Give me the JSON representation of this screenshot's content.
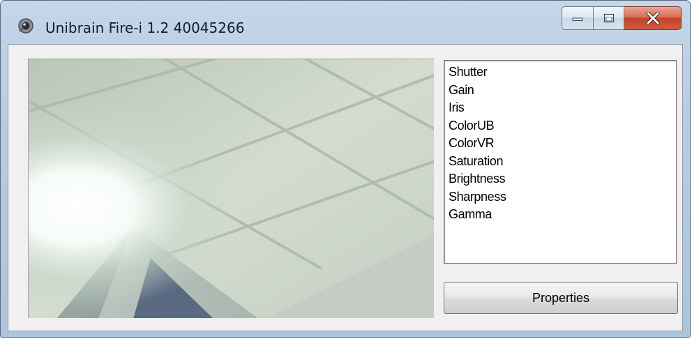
{
  "window": {
    "title": "Unibrain Fire-i 1.2 40045266"
  },
  "caption_buttons": {
    "minimize_icon": "minimize-icon",
    "maximize_icon": "maximize-icon",
    "close_icon": "close-icon"
  },
  "preview": {
    "icon": "camera-preview-image"
  },
  "property_list": {
    "items": [
      "Shutter",
      "Gain",
      "Iris",
      "ColorUB",
      "ColorVR",
      "Saturation",
      "Brightness",
      "Sharpness",
      "Gamma"
    ]
  },
  "properties_button": {
    "label": "Properties"
  },
  "colors": {
    "titlebar": "#b7cbe0",
    "client": "#f0f0f0",
    "close_button": "#c3442a"
  }
}
